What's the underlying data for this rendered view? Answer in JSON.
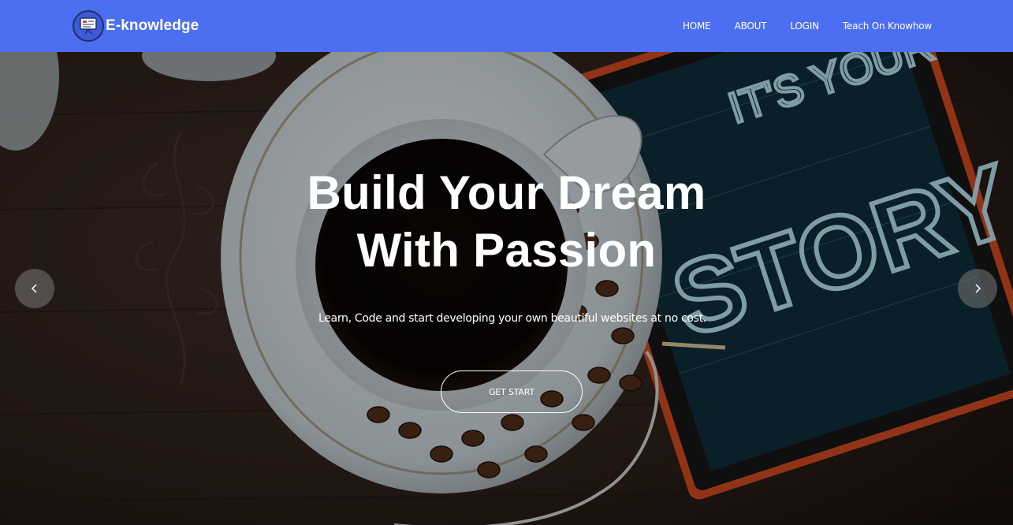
{
  "navbar": {
    "brand_name": "E-knowledge",
    "brand_icon": "presentation-board-icon",
    "links": [
      {
        "label": "HOME"
      },
      {
        "label": "ABOUT"
      },
      {
        "label": "LOGIN"
      },
      {
        "label": "Teach On Knowhow"
      }
    ],
    "background_color": "#4c6ef0"
  },
  "hero": {
    "title_line1": "Build Your Dream",
    "title_line2": "With Passion",
    "subtitle": "Learn, Code and start developing your own beautiful websites at no cost.",
    "cta_label": "GET START",
    "prev_icon": "chevron-left-icon",
    "next_icon": "chevron-right-icon",
    "chalkboard_text_1": "STORY",
    "chalkboard_text_2": "IT'S YOUR"
  }
}
